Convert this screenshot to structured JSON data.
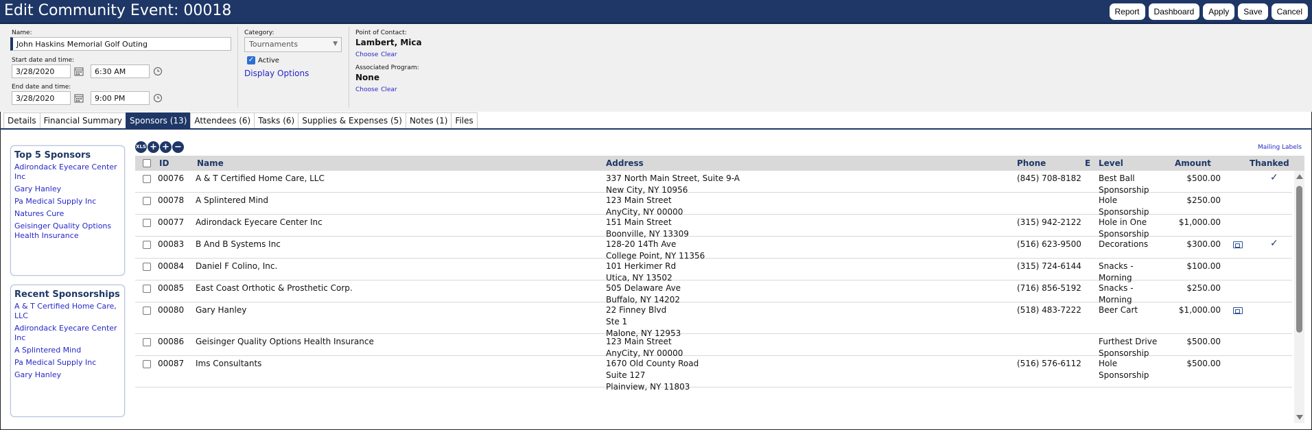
{
  "header": {
    "title": "Edit Community Event: 00018",
    "buttons": [
      "Report",
      "Dashboard",
      "Apply",
      "Save",
      "Cancel"
    ]
  },
  "form": {
    "name_label": "Name:",
    "name_value": "John Haskins Memorial Golf Outing",
    "start_label": "Start date and time:",
    "start_date": "3/28/2020",
    "start_time": "6:30 AM",
    "end_label": "End date and time:",
    "end_date": "3/28/2020",
    "end_time": "9:00 PM",
    "category_label": "Category:",
    "category_value": "Tournaments",
    "active_label": "Active",
    "active_checked": true,
    "display_options": "Display Options",
    "poc_label": "Point of Contact:",
    "poc_value": "Lambert, Mica",
    "poc_choose": "Choose",
    "poc_clear": "Clear",
    "program_label": "Associated Program:",
    "program_value": "None",
    "program_choose": "Choose",
    "program_clear": "Clear"
  },
  "tabs": [
    {
      "label": "Details"
    },
    {
      "label": "Financial Summary"
    },
    {
      "label": "Sponsors (13)",
      "active": true
    },
    {
      "label": "Attendees (6)"
    },
    {
      "label": "Tasks (6)"
    },
    {
      "label": "Supplies & Expenses (5)"
    },
    {
      "label": "Notes (1)"
    },
    {
      "label": "Files"
    }
  ],
  "top_sponsors": {
    "title": "Top 5 Sponsors",
    "items": [
      "Adirondack Eyecare Center Inc",
      "Gary Hanley",
      "Pa Medical Supply Inc",
      "Natures Cure",
      "Geisinger Quality Options Health Insurance"
    ]
  },
  "recent_sponsorships": {
    "title": "Recent Sponsorships",
    "items": [
      "A & T Certified Home Care, LLC",
      "Adirondack Eyecare Center Inc",
      "A Splintered Mind",
      "Pa Medical Supply Inc",
      "Gary Hanley"
    ]
  },
  "grid": {
    "toolbar": {
      "xls": "XLS",
      "add": "+",
      "add_multi": "+",
      "remove": "−"
    },
    "mailing_labels": "Mailing Labels",
    "columns": {
      "id": "ID",
      "name": "Name",
      "address": "Address",
      "phone": "Phone",
      "e": "E",
      "level": "Level",
      "amount": "Amount",
      "thanked": "Thanked"
    },
    "rows": [
      {
        "id": "00076",
        "name": "A & T Certified Home Care, LLC",
        "address": [
          "337 North Main Street, Suite 9-A",
          "New City, NY 10956"
        ],
        "phone": "(845) 708-8182",
        "level": [
          "Best Ball",
          "Sponsorship"
        ],
        "amount": "$500.00",
        "email": false,
        "thanked": true
      },
      {
        "id": "00078",
        "name": "A Splintered Mind",
        "address": [
          "123 Main Street",
          "AnyCity, NY 00000"
        ],
        "phone": "",
        "level": [
          "Hole",
          "Sponsorship"
        ],
        "amount": "$250.00",
        "email": false,
        "thanked": false
      },
      {
        "id": "00077",
        "name": "Adirondack Eyecare Center Inc",
        "address": [
          "151 Main Street",
          "Boonville, NY 13309"
        ],
        "phone": "(315) 942-2122",
        "level": [
          "Hole in One",
          "Sponsorship"
        ],
        "amount": "$1,000.00",
        "email": false,
        "thanked": false
      },
      {
        "id": "00083",
        "name": "B And B Systems Inc",
        "address": [
          "128-20 14Th Ave",
          "College Point, NY 11356"
        ],
        "phone": "(516) 623-9500",
        "level": [
          "Decorations"
        ],
        "amount": "$300.00",
        "email": true,
        "thanked": true
      },
      {
        "id": "00084",
        "name": "Daniel F Colino, Inc.",
        "address": [
          "101 Herkimer Rd",
          "Utica, NY 13502"
        ],
        "phone": "(315) 724-6144",
        "level": [
          "Snacks -",
          "Morning"
        ],
        "amount": "$100.00",
        "email": false,
        "thanked": false
      },
      {
        "id": "00085",
        "name": "East Coast Orthotic & Prosthetic Corp.",
        "address": [
          "505 Delaware Ave",
          "Buffalo, NY 14202"
        ],
        "phone": "(716) 856-5192",
        "level": [
          "Snacks -",
          "Morning"
        ],
        "amount": "$250.00",
        "email": false,
        "thanked": false
      },
      {
        "id": "00080",
        "name": "Gary Hanley",
        "address": [
          "22 Finney Blvd",
          "Ste 1",
          "Malone, NY 12953"
        ],
        "phone": "(518) 483-7222",
        "level": [
          "Beer Cart"
        ],
        "amount": "$1,000.00",
        "email": true,
        "thanked": false
      },
      {
        "id": "00086",
        "name": "Geisinger Quality Options Health Insurance",
        "address": [
          "123 Main Street",
          "AnyCity, NY 00000"
        ],
        "phone": "",
        "level": [
          "Furthest Drive",
          "Sponsorship"
        ],
        "amount": "$500.00",
        "email": false,
        "thanked": false
      },
      {
        "id": "00087",
        "name": "Ims Consultants",
        "address": [
          "1670 Old County Road",
          "Suite 127",
          "Plainview, NY 11803"
        ],
        "phone": "(516) 576-6112",
        "level": [
          "Hole",
          "Sponsorship"
        ],
        "amount": "$500.00",
        "email": false,
        "thanked": false
      }
    ]
  },
  "colors": {
    "navy": "#1e3766",
    "link": "#2626c8",
    "header_gray": "#d9d9d9"
  }
}
